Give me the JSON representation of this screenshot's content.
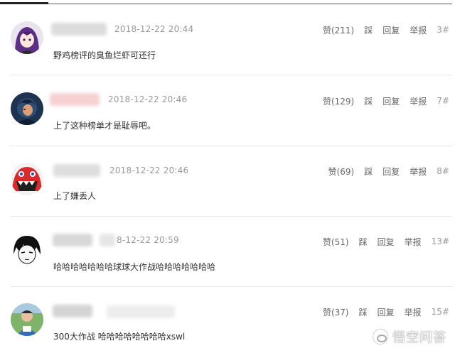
{
  "comments": [
    {
      "time": "2018-12-22 20:44",
      "likes": "赞(211)",
      "step": "踩",
      "reply": "回复",
      "report": "举报",
      "floor": "3#",
      "text": "野鸡榜评的臭鱼烂虾可还行"
    },
    {
      "time": "2018-12-22 20:46",
      "likes": "赞(129)",
      "step": "踩",
      "reply": "回复",
      "report": "举报",
      "floor": "7#",
      "text": "上了这种榜单才是耻辱吧。"
    },
    {
      "time": "2018-12-22 20:46",
      "likes": "赞(69)",
      "step": "踩",
      "reply": "回复",
      "report": "举报",
      "floor": "8#",
      "text": "上了嫌丢人"
    },
    {
      "time": "8-12-22 20:59",
      "likes": "赞(51)",
      "step": "踩",
      "reply": "回复",
      "report": "举报",
      "floor": "13#",
      "text": "哈哈哈哈哈哈哈球球大作战哈哈哈哈哈哈哈"
    },
    {
      "time": "",
      "likes": "赞(37)",
      "step": "踩",
      "reply": "回复",
      "report": "举报",
      "floor": "15#",
      "text": "300大作战 哈哈哈哈哈哈哈哈xswl"
    }
  ],
  "watermark": {
    "text": "悟空问答"
  },
  "colors": {
    "meta": "#999999",
    "text": "#333333",
    "action": "#666666",
    "divider": "#e6e6e6"
  }
}
